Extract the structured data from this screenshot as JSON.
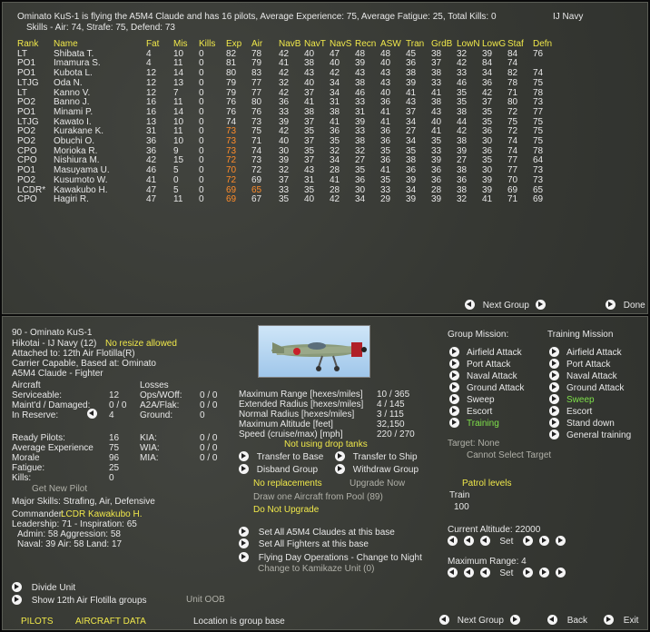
{
  "header": {
    "line1": "Ominato KuS-1 is flying the A5M4 Claude and has 16 pilots,  Average Experience: 75,  Average Fatigue: 25, Total Kills: 0",
    "service": "IJ Navy",
    "line2": "Skills - Air: 74, Strafe: 75, Defend: 73"
  },
  "roster": {
    "columns": [
      "Rank",
      "Name",
      "Fat",
      "Mis",
      "Kills",
      "Exp",
      "Air",
      "NavB",
      "NavT",
      "NavS",
      "Recn",
      "ASW",
      "Tran",
      "GrdB",
      "LowN",
      "LowG",
      "Staf",
      "Defn"
    ],
    "rows": [
      [
        "LT",
        "Shibata T.",
        "4",
        "10",
        "0",
        "82",
        "78",
        "42",
        "40",
        "47",
        "48",
        "48",
        "45",
        "38",
        "32",
        "39",
        "84",
        "76"
      ],
      [
        "PO1",
        "Imamura S.",
        "4",
        "11",
        "0",
        "81",
        "79",
        "41",
        "38",
        "40",
        "39",
        "40",
        "36",
        "37",
        "42",
        "84",
        "74",
        ""
      ],
      [
        "PO1",
        "Kubota L.",
        "12",
        "14",
        "0",
        "80",
        "83",
        "42",
        "43",
        "42",
        "43",
        "43",
        "38",
        "38",
        "33",
        "34",
        "82",
        "74"
      ],
      [
        "LTJG",
        "Oda N.",
        "12",
        "13",
        "0",
        "79",
        "77",
        "32",
        "40",
        "34",
        "38",
        "43",
        "39",
        "33",
        "46",
        "36",
        "78",
        "75"
      ],
      [
        "LT",
        "Kanno V.",
        "12",
        "7",
        "0",
        "79",
        "77",
        "42",
        "37",
        "34",
        "46",
        "40",
        "41",
        "41",
        "35",
        "42",
        "71",
        "78"
      ],
      [
        "PO2",
        "Banno J.",
        "16",
        "11",
        "0",
        "76",
        "80",
        "36",
        "41",
        "31",
        "33",
        "36",
        "43",
        "38",
        "35",
        "37",
        "80",
        "73"
      ],
      [
        "PO1",
        "Minami P.",
        "16",
        "14",
        "0",
        "76",
        "76",
        "33",
        "38",
        "38",
        "31",
        "41",
        "37",
        "43",
        "38",
        "35",
        "72",
        "77"
      ],
      [
        "LTJG",
        "Kawato I.",
        "13",
        "10",
        "0",
        "74",
        "73",
        "39",
        "37",
        "41",
        "39",
        "41",
        "34",
        "40",
        "44",
        "35",
        "75",
        "75"
      ],
      [
        "PO2",
        "Kurakane K.",
        "31",
        "11",
        "0",
        "73",
        "75",
        "42",
        "35",
        "36",
        "33",
        "36",
        "27",
        "41",
        "42",
        "36",
        "72",
        "75"
      ],
      [
        "PO2",
        "Obuchi O.",
        "36",
        "10",
        "0",
        "73",
        "71",
        "40",
        "37",
        "35",
        "38",
        "36",
        "34",
        "35",
        "38",
        "30",
        "74",
        "75"
      ],
      [
        "CPO",
        "Morioka R.",
        "36",
        "9",
        "0",
        "73",
        "74",
        "30",
        "35",
        "32",
        "32",
        "35",
        "35",
        "33",
        "39",
        "36",
        "74",
        "78"
      ],
      [
        "CPO",
        "Nishiura M.",
        "42",
        "15",
        "0",
        "72",
        "73",
        "39",
        "37",
        "34",
        "27",
        "36",
        "38",
        "39",
        "27",
        "35",
        "77",
        "64"
      ],
      [
        "PO1",
        "Masuyama U.",
        "46",
        "5",
        "0",
        "70",
        "72",
        "32",
        "43",
        "28",
        "35",
        "41",
        "36",
        "36",
        "38",
        "30",
        "77",
        "73"
      ],
      [
        "PO2",
        "Kusumoto W.",
        "41",
        "0",
        "0",
        "72",
        "69",
        "37",
        "31",
        "41",
        "36",
        "35",
        "39",
        "36",
        "36",
        "39",
        "70",
        "73"
      ],
      [
        "LCDR*",
        "Kawakubo H.",
        "47",
        "5",
        "0",
        "69",
        "65",
        "33",
        "35",
        "28",
        "30",
        "33",
        "34",
        "28",
        "38",
        "39",
        "69",
        "65"
      ],
      [
        "CPO",
        "Hagiri R.",
        "47",
        "11",
        "0",
        "69",
        "67",
        "35",
        "40",
        "42",
        "34",
        "29",
        "39",
        "39",
        "32",
        "41",
        "71",
        "69"
      ]
    ]
  },
  "nav_top": {
    "next_group": "Next Group",
    "done": "Done"
  },
  "unit": {
    "title": "90 - Ominato KuS-1",
    "service": "Hikotai - IJ Navy (12)",
    "no_resize": "No resize allowed",
    "attached": "Attached to:  12th Air Flotilla(R)",
    "carrier": "Carrier Capable, Based at:  Ominato",
    "aircraft_type": "A5M4 Claude - Fighter"
  },
  "aircraft": {
    "heading": "Aircraft",
    "serviceable_label": "Serviceable:",
    "serviceable": "12",
    "maint_label": "Maint'd / Damaged:",
    "maint": "0 / 0",
    "reserve_label": "In Reserve:",
    "reserve": "4"
  },
  "losses": {
    "heading": "Losses",
    "ops_label": "Ops/WOff:",
    "ops": "0 / 0",
    "a2a_label": "A2A/Flak:",
    "a2a": "0 / 0",
    "ground_label": "Ground:",
    "ground": "0"
  },
  "pilots_stats": {
    "ready_label": "Ready Pilots:",
    "ready": "16",
    "exp_label": "Average Experience",
    "exp": "75",
    "morale_label": "Morale",
    "morale": "96",
    "fatigue_label": "Fatigue:",
    "fatigue": "25",
    "kills_label": "Kills:",
    "kills": "0",
    "kia_label": "KIA:",
    "kia": "0 / 0",
    "wia_label": "WIA:",
    "wia": "0 / 0",
    "mia_label": "MIA:",
    "mia": "0 / 0"
  },
  "get_new_pilot": "Get New Pilot",
  "major_skills": "Major Skills: Strafing, Air, Defensive",
  "commander": {
    "label": "Commander:",
    "name": "LCDR Kawakubo H.",
    "line1": "Leadership: 71 - Inspiration: 65",
    "line2": "Admin: 58  Aggression: 58",
    "line3": "Naval: 39  Air: 58  Land: 17"
  },
  "ranges": {
    "max_label": "Maximum Range [hexes/miles]",
    "max": "10 / 365",
    "ext_label": "Extended Radius [hexes/miles]",
    "ext": "4 / 145",
    "norm_label": "Normal Radius [hexes/miles]",
    "norm": "3 / 115",
    "alt_label": "Maximum Altitude [feet]",
    "alt": "32,150",
    "speed_label": "Speed (cruise/max) [mph]",
    "speed": "220 / 270",
    "drop_tanks": "Not using drop tanks"
  },
  "actions": {
    "transfer_base": "Transfer to Base",
    "transfer_ship": "Transfer to Ship",
    "disband": "Disband Group",
    "withdraw": "Withdraw Group",
    "no_repl": "No replacements",
    "upgrade_now": "Upgrade Now",
    "draw_pool": "Draw one Aircraft from Pool (89)",
    "no_upgrade": "Do Not Upgrade",
    "set_all_claudes": "Set All A5M4 Claudes at this base",
    "set_all_fighters": "Set All Fighters at this base",
    "flying_day": "Flying Day Operations - Change to Night",
    "kamikaze": "Change to Kamikaze Unit (0)"
  },
  "group_mission": {
    "heading": "Group Mission:",
    "items": [
      "Airfield Attack",
      "Port Attack",
      "Naval Attack",
      "Ground Attack",
      "Sweep",
      "Escort",
      "Training"
    ],
    "target": "Target: None",
    "cannot": "Cannot Select Target"
  },
  "training_mission": {
    "heading": "Training Mission",
    "items": [
      "Airfield Attack",
      "Port Attack",
      "Naval Attack",
      "Ground Attack",
      "Sweep",
      "Escort",
      "Stand down",
      "General training"
    ]
  },
  "patrol": {
    "heading": "Patrol levels",
    "train_label": "Train",
    "train_value": "100"
  },
  "altitude": {
    "label": "Current Altitude: 22000",
    "set": "Set"
  },
  "max_range": {
    "label": "Maximum Range: 4",
    "set": "Set"
  },
  "divide": "Divide Unit",
  "show_groups": "Show 12th Air Flotilla  groups",
  "unit_oob": "Unit OOB",
  "footer": {
    "pilots": "PILOTS",
    "aircraft_data": "AIRCRAFT DATA",
    "location": "Location is group base",
    "next_group": "Next Group",
    "back": "Back",
    "exit": "Exit"
  },
  "colors": {
    "highlight_yellow": "#f0e84a",
    "highlight_green": "#7ee04a",
    "highlight_orange": "#ff8c2a"
  }
}
